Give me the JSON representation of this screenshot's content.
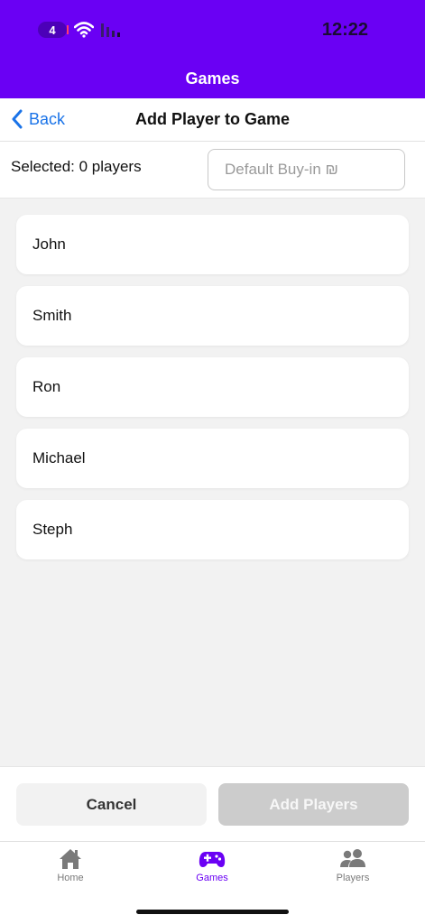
{
  "status_bar": {
    "badge": "4",
    "time": "12:22"
  },
  "app_bar": {
    "title": "Games"
  },
  "nav": {
    "back_label": "Back",
    "title": "Add Player to Game"
  },
  "selection": {
    "count_text": "Selected: 0 players",
    "buyin_placeholder": "Default Buy-in ₪",
    "buyin_value": ""
  },
  "players": [
    {
      "name": "John"
    },
    {
      "name": "Smith"
    },
    {
      "name": "Ron"
    },
    {
      "name": "Michael"
    },
    {
      "name": "Steph"
    }
  ],
  "actions": {
    "cancel_label": "Cancel",
    "add_label": "Add Players"
  },
  "tabs": [
    {
      "label": "Home",
      "icon": "home-icon",
      "active": false
    },
    {
      "label": "Games",
      "icon": "gamepad-icon",
      "active": true
    },
    {
      "label": "Players",
      "icon": "people-icon",
      "active": false
    }
  ],
  "colors": {
    "brand": "#6a00f4",
    "link": "#1a73e8",
    "disabled_button": "#cccccc"
  }
}
